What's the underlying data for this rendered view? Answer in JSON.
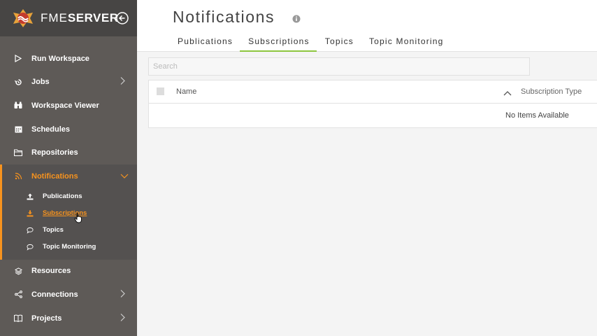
{
  "brand": {
    "fme": "FME",
    "server": "SERVER"
  },
  "sidebar": {
    "items": [
      {
        "label": "Run Workspace",
        "icon": "play-icon"
      },
      {
        "label": "Jobs",
        "icon": "history-icon"
      },
      {
        "label": "Workspace Viewer",
        "icon": "binoculars-icon"
      },
      {
        "label": "Schedules",
        "icon": "calendar-icon"
      },
      {
        "label": "Repositories",
        "icon": "folder-icon"
      },
      {
        "label": "Notifications",
        "icon": "rss-icon"
      },
      {
        "label": "Resources",
        "icon": "layers-icon"
      },
      {
        "label": "Connections",
        "icon": "share-icon"
      },
      {
        "label": "Projects",
        "icon": "book-icon"
      }
    ],
    "notifications_sub": [
      {
        "label": "Publications",
        "icon": "upload-icon"
      },
      {
        "label": "Subscriptions",
        "icon": "download-icon"
      },
      {
        "label": "Topics",
        "icon": "comment-icon"
      },
      {
        "label": "Topic Monitoring",
        "icon": "comment-icon"
      }
    ],
    "accent": "#f7931e"
  },
  "main": {
    "title": "Notifications",
    "tabs": [
      "Publications",
      "Subscriptions",
      "Topics",
      "Topic Monitoring"
    ],
    "active_tab": "Subscriptions",
    "search_placeholder": "Search",
    "table": {
      "columns": [
        "Name",
        "Subscription Type"
      ],
      "empty_text": "No Items Available"
    },
    "tab_accent": "#8dc63f"
  }
}
